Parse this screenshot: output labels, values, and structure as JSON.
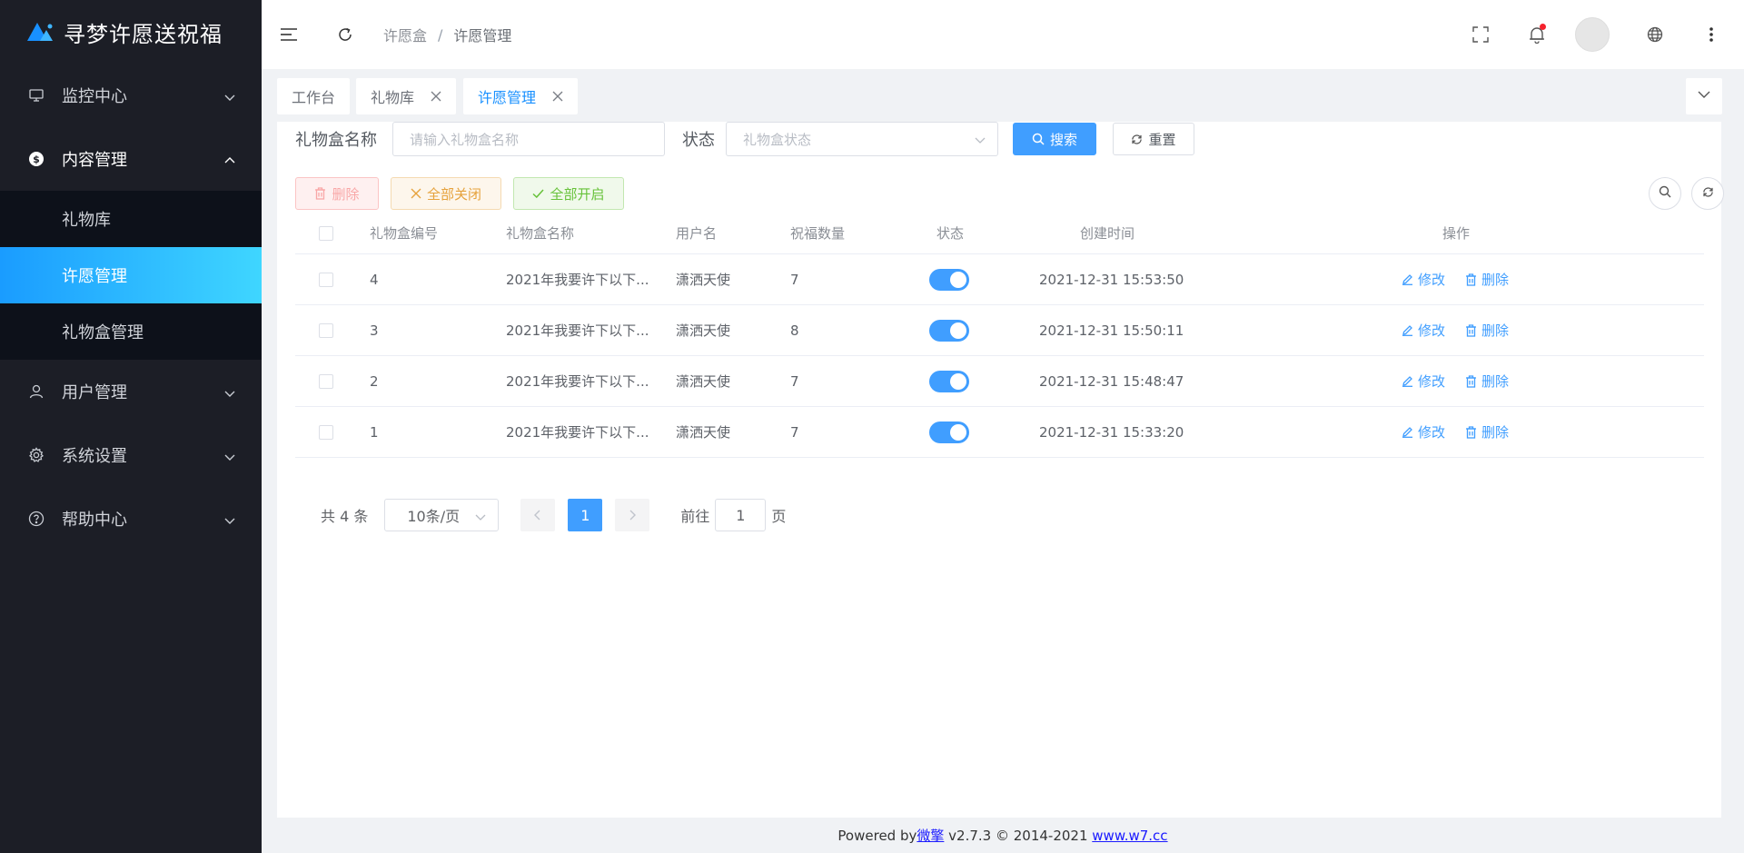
{
  "app": {
    "title": "寻梦许愿送祝福"
  },
  "sidebar": {
    "items": [
      {
        "label": "监控中心",
        "icon": "monitor-icon"
      },
      {
        "label": "内容管理",
        "icon": "dollar-circle-icon"
      },
      {
        "label": "用户管理",
        "icon": "user-icon"
      },
      {
        "label": "系统设置",
        "icon": "gear-icon"
      },
      {
        "label": "帮助中心",
        "icon": "question-circle-icon"
      }
    ],
    "submenu": [
      {
        "label": "礼物库"
      },
      {
        "label": "许愿管理"
      },
      {
        "label": "礼物盒管理"
      }
    ]
  },
  "header": {
    "breadcrumb": [
      "许愿盒",
      "/",
      "许愿管理"
    ]
  },
  "tabs": [
    {
      "label": "工作台"
    },
    {
      "label": "礼物库"
    },
    {
      "label": "许愿管理"
    }
  ],
  "search": {
    "name_label": "礼物盒名称",
    "name_placeholder": "请输入礼物盒名称",
    "status_label": "状态",
    "status_placeholder": "礼物盒状态",
    "search_btn": "搜索",
    "reset_btn": "重置"
  },
  "toolbar": {
    "delete": "删除",
    "close_all": "全部关闭",
    "open_all": "全部开启"
  },
  "table": {
    "headers": [
      "礼物盒编号",
      "礼物盒名称",
      "用户名",
      "祝福数量",
      "状态",
      "创建时间",
      "操作"
    ],
    "rows": [
      {
        "id": "4",
        "name": "2021年我要许下以下...",
        "user": "潇洒天使",
        "count": "7",
        "time": "2021-12-31 15:53:50"
      },
      {
        "id": "3",
        "name": "2021年我要许下以下...",
        "user": "潇洒天使",
        "count": "8",
        "time": "2021-12-31 15:50:11"
      },
      {
        "id": "2",
        "name": "2021年我要许下以下...",
        "user": "潇洒天使",
        "count": "7",
        "time": "2021-12-31 15:48:47"
      },
      {
        "id": "1",
        "name": "2021年我要许下以下...",
        "user": "潇洒天使",
        "count": "7",
        "time": "2021-12-31 15:33:20"
      }
    ],
    "edit_label": "修改",
    "delete_label": "删除"
  },
  "pager": {
    "total": "共 4 条",
    "size": "10条/页",
    "page": "1",
    "goto_prefix": "前往",
    "goto_value": "1",
    "goto_suffix": "页"
  },
  "footer": {
    "powered": "Powered by ",
    "brand": "微擎",
    "version": " v2.7.3 © 2014-2021 ",
    "site": "www.w7.cc"
  },
  "colors": {
    "primary": "#409eff",
    "sidebar_bg": "#1c1e26",
    "active_gradient_start": "#1a9cff",
    "active_gradient_end": "#3fd6ff"
  }
}
